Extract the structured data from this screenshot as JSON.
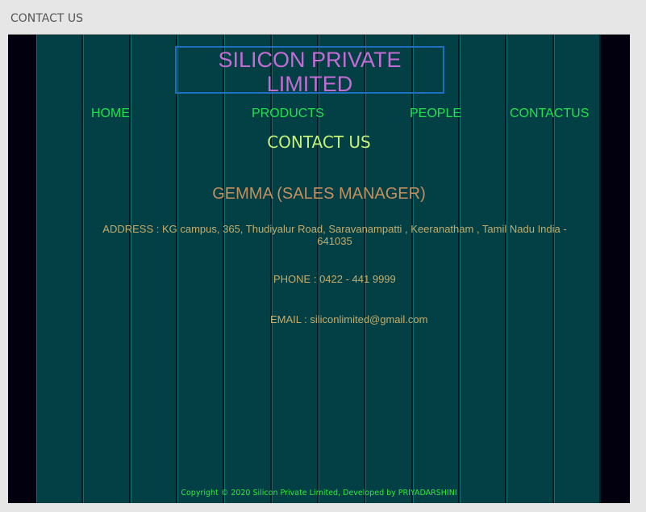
{
  "window": {
    "title": "CONTACT US"
  },
  "header": {
    "site_title": "SILICON PRIVATE LIMITED"
  },
  "nav": {
    "items": [
      {
        "label": "HOME"
      },
      {
        "label": "PRODUCTS"
      },
      {
        "label": "PEOPLE"
      },
      {
        "label": "CONTACTUS"
      }
    ]
  },
  "main": {
    "heading": "CONTACT US",
    "contact_name": "GEMMA (SALES MANAGER)",
    "address": "ADDRESS : KG campus, 365, Thudiyalur Road, Saravanampatti , Keeranatham   , Tamil Nadu India - 641035",
    "phone": "PHONE :  0422 - 441 9999",
    "email": "EMAIL : siliconlimited@gmail.com"
  },
  "footer": {
    "copyright": "Copyright © 2020 Silicon Private Limited, Developed by PRIYADARSHINI"
  },
  "colors": {
    "background": "#02000f",
    "stripe": "#034046",
    "title": "#c46bd4",
    "nav": "#1ee14e",
    "heading": "#c4f279",
    "body_text": "#c5ad6a",
    "footer_text": "#2de83a"
  }
}
